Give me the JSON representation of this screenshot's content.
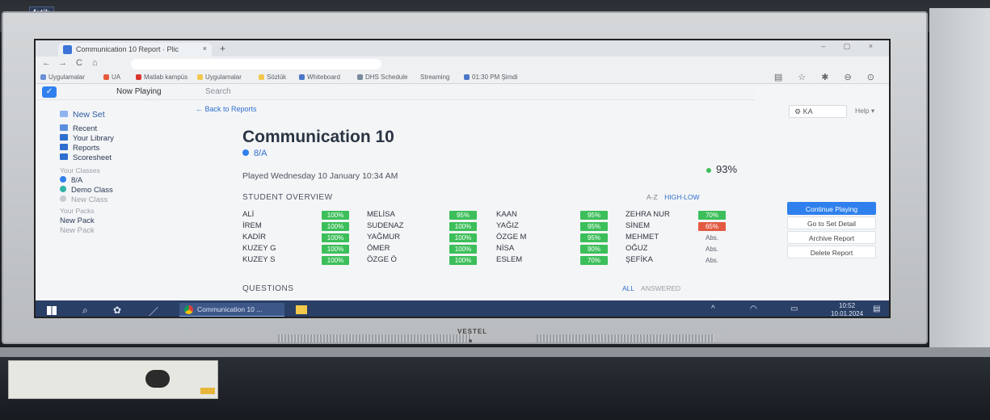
{
  "sticker": "fatih",
  "browser": {
    "tab_title": "Communication 10 Report · Plic",
    "tab_close": "×",
    "new_tab": "+",
    "window_controls": "– ▢ ×",
    "nav": {
      "back": "←",
      "forward": "→",
      "reload": "C",
      "home": "⌂"
    },
    "bookmarks": [
      "Uygulamalar",
      "UA",
      "Matlab kampüs",
      "Uygulamalar",
      "Sözlük",
      "Whiteboard",
      "DHS Schedule",
      "Streaming",
      "01:30 PM Şimdi"
    ],
    "toolbar_icons": "▤ ☆ ✱ ⊖ ⊙"
  },
  "app": {
    "logo": "✓",
    "nav": {
      "now_playing": "Now Playing",
      "search": "Search"
    },
    "sidebar": {
      "new_set": "New Set",
      "recent": "Recent",
      "your_library": "Your Library",
      "reports": "Reports",
      "scoresheet": "Scoresheet",
      "your_classes_heading": "Your Classes",
      "classes": [
        "8/A",
        "Demo Class",
        "New Class"
      ],
      "your_packs_heading": "Your Packs",
      "new_pack": "New Pack",
      "new_pack_placeholder": "New Pack"
    },
    "report": {
      "back_link": "Back to Reports",
      "title": "Communication 10",
      "class_name": "8/A",
      "played": "Played Wednesday 10 January 10:34 AM",
      "overview_heading": "STUDENT OVERVIEW",
      "sort_az": "A-Z",
      "sort_high_low": "HIGH-LOW",
      "overall_score": "93%",
      "students": [
        [
          {
            "name": "ALİ",
            "score": "100%"
          },
          {
            "name": "MELİSA",
            "score": "95%"
          },
          {
            "name": "KAAN",
            "score": "95%"
          },
          {
            "name": "ZEHRA NUR",
            "score": "70%"
          }
        ],
        [
          {
            "name": "İREM",
            "score": "100%"
          },
          {
            "name": "SUDENAZ",
            "score": "100%"
          },
          {
            "name": "YAĞIZ",
            "score": "95%"
          },
          {
            "name": "SİNEM",
            "score": "65%"
          }
        ],
        [
          {
            "name": "KADİR",
            "score": "100%"
          },
          {
            "name": "YAĞMUR",
            "score": "100%"
          },
          {
            "name": "ÖZGE M",
            "score": "95%"
          },
          {
            "name": "MEHMET",
            "score": "Abs."
          }
        ],
        [
          {
            "name": "KUZEY G",
            "score": "100%"
          },
          {
            "name": "ÖMER",
            "score": "100%"
          },
          {
            "name": "NİSA",
            "score": "90%"
          },
          {
            "name": "OĞUZ",
            "score": "Abs."
          }
        ],
        [
          {
            "name": "KUZEY S",
            "score": "100%"
          },
          {
            "name": "ÖZGE Ö",
            "score": "100%"
          },
          {
            "name": "ESLEM",
            "score": "70%"
          },
          {
            "name": "ŞEFİKA",
            "score": "Abs."
          }
        ]
      ],
      "questions_heading": "QUESTIONS",
      "filter_all": "ALL",
      "filter_answered": "ANSWERED"
    },
    "right": {
      "user": "KA",
      "user_icon": "⚙",
      "help": "Help ▾",
      "continue_playing": "Continue Playing",
      "go_to_set_detail": "Go to Set Detail",
      "archive_report": "Archive Report",
      "delete_report": "Delete Report"
    }
  },
  "taskbar": {
    "app_label": "Communication 10 ...",
    "time": "10:52",
    "date": "10.01.2024",
    "chevron": "^"
  },
  "monitor_brand": "VESTEL",
  "colors": {
    "green": "#3cbf5a",
    "red": "#e35a44",
    "blue": "#2f80ed"
  }
}
